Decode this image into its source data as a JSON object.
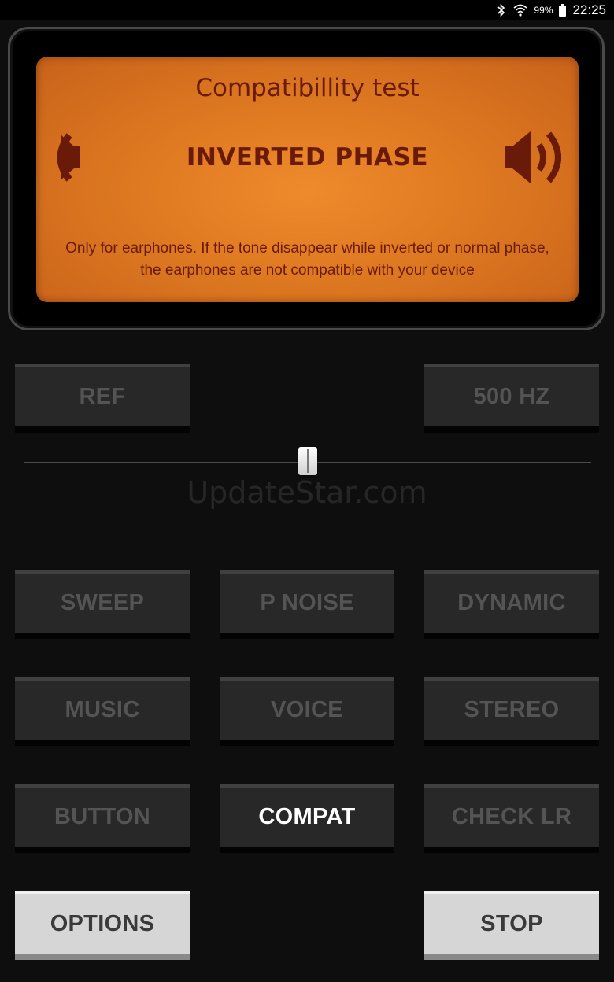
{
  "status_bar": {
    "battery_percent": "99%",
    "time": "22:25",
    "icons": [
      "bluetooth-icon",
      "wifi-icon",
      "battery-icon"
    ]
  },
  "display": {
    "title": "Compatibillity test",
    "mode": "INVERTED PHASE",
    "note": "Only for earphones. If the tone disappear while inverted or normal phase, the earphones are not compatible with your device",
    "left_icon": "speaker-inverted-icon",
    "right_icon": "speaker-icon"
  },
  "controls": {
    "ref_label": "REF",
    "freq_label": "500 HZ",
    "slider_value": 0.5
  },
  "watermark": "UpdateStar.com",
  "buttons": {
    "sweep": "SWEEP",
    "pnoise": "P NOISE",
    "dynamic": "DYNAMIC",
    "music": "MUSIC",
    "voice": "VOICE",
    "stereo": "STEREO",
    "button": "BUTTON",
    "compat": "COMPAT",
    "checklr": "CHECK LR",
    "options": "OPTIONS",
    "stop": "STOP"
  },
  "colors": {
    "display_orange": "#e07b22",
    "display_text": "#6a1a08",
    "active_button_text": "#ffffff",
    "inactive_button_text": "#545454"
  }
}
